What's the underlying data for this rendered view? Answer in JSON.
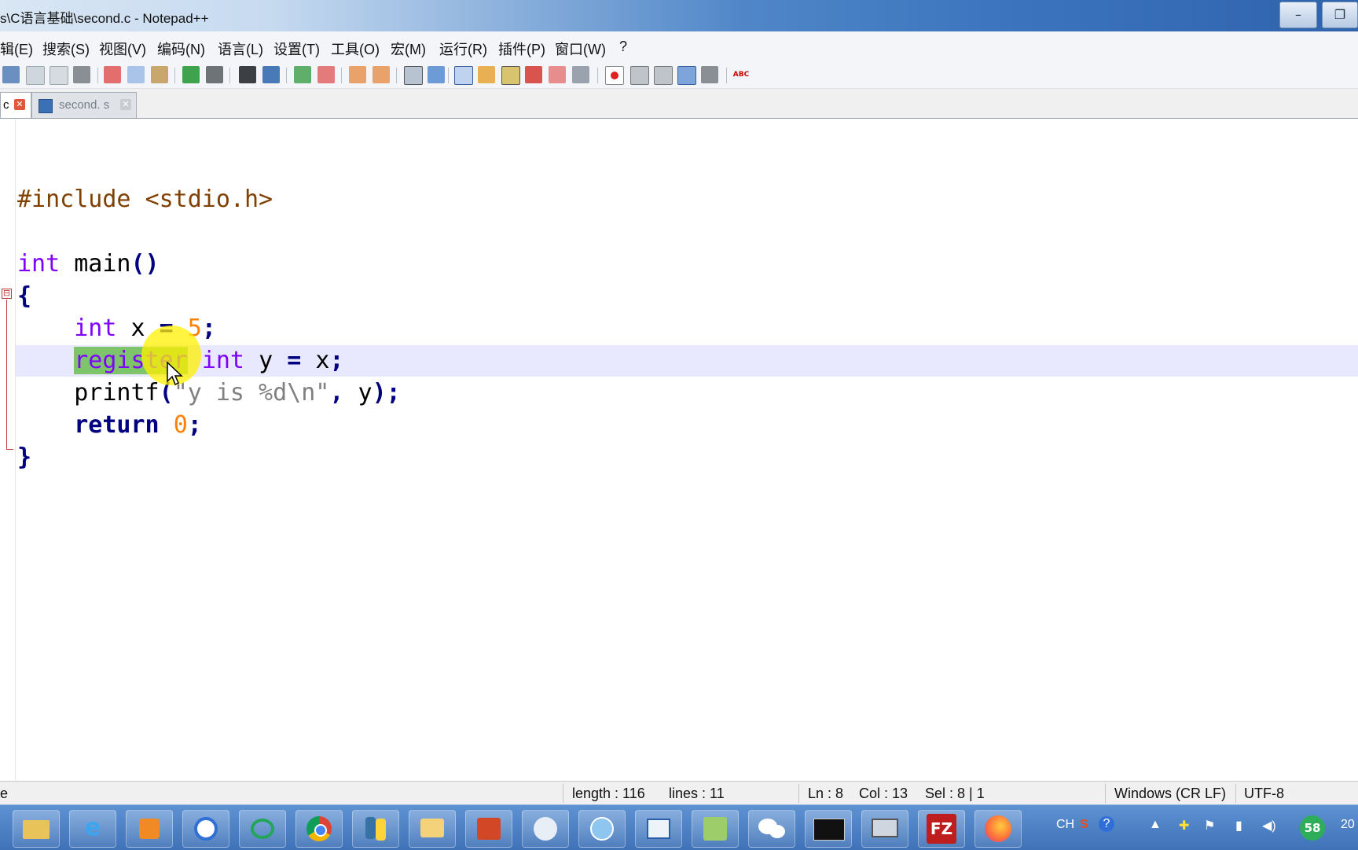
{
  "window": {
    "title": "s\\C语言基础\\second.c - Notepad++",
    "minimize_glyph": "–",
    "restore_glyph": "❐"
  },
  "menu": {
    "items": [
      "辑(E)",
      "搜索(S)",
      "视图(V)",
      "编码(N)",
      "语言(L)",
      "设置(T)",
      "工具(O)",
      "宏(M)",
      "运行(R)",
      "插件(P)",
      "窗口(W)",
      "?"
    ]
  },
  "toolbar": {
    "icons": [
      "new-file-icon",
      "open-file-icon",
      "save-icon",
      "save-all-icon",
      "close-icon",
      "close-all-icon",
      "print-icon",
      "cut-icon",
      "copy-icon",
      "paste-icon",
      "undo-icon",
      "redo-icon",
      "find-icon",
      "replace-icon",
      "zoom-in-icon",
      "zoom-out-icon",
      "sync-v-icon",
      "sync-h-icon",
      "word-wrap-icon",
      "show-all-chars-icon",
      "indent-guide-icon",
      "user-lang-icon",
      "doc-map-icon",
      "function-list-icon",
      "folder-workspace-icon",
      "monitor-icon",
      "record-macro-icon",
      "stop-record-icon",
      "playback-icon",
      "run-multiple-icon",
      "save-macro-icon",
      "spellcheck-icon"
    ],
    "spellcheck_label": "ABC"
  },
  "tabs": [
    {
      "label": "c",
      "active": true
    },
    {
      "label": "second. s",
      "active": false
    }
  ],
  "tab_close_glyph": "✕",
  "editor": {
    "fold_open": "⊟",
    "lines": {
      "include_kw": "#include",
      "include_file": "<stdio.h>",
      "int_kw": "int",
      "main_name": "main",
      "main_parens": "()",
      "brace_open": "{",
      "l5_int": "int",
      "l5_var": "x",
      "l5_eq": "=",
      "l5_num": "5",
      "l5_semi": ";",
      "l6_register": "register",
      "l6_int": "int",
      "l6_var": "y",
      "l6_eq": "=",
      "l6_src": "x",
      "l6_semi": ";",
      "l7_func": "printf",
      "l7_paren_open": "(",
      "l7_str": "\"y is %d\\n\"",
      "l7_comma": ",",
      "l7_arg": "y",
      "l7_paren_close": ")",
      "l7_semi": ";",
      "l8_return": "return",
      "l8_num": "0",
      "l8_semi": ";",
      "brace_close": "}"
    }
  },
  "status": {
    "file_type": "e",
    "length": "length : 116",
    "lines": "lines : 11",
    "ln": "Ln : 8",
    "col": "Col : 13",
    "sel": "Sel : 8 | 1",
    "eol": "Windows (CR LF)",
    "encoding": "UTF-8"
  },
  "taskbar": {
    "apps": [
      "file-explorer-icon",
      "internet-explorer-icon",
      "media-player-icon",
      "baidu-netdisk-icon",
      "cloud-app-icon",
      "chrome-icon",
      "python-icon",
      "outlook-icon",
      "powerpoint-icon",
      "app-bird-icon",
      "network-icon",
      "document-viewer-icon",
      "notepad-plus-plus-icon",
      "wechat-icon",
      "cmd-terminal-icon",
      "remote-desktop-icon",
      "filezilla-icon",
      "firefox-icon"
    ],
    "filezilla_glyph": "FZ",
    "tray_lang": "CH",
    "tray_badge": "58",
    "clock_partial": "20"
  },
  "colors": {
    "keyword": "#8000ff",
    "keyword_bold": "#000080",
    "number": "#ff8000",
    "string": "#808080",
    "preprocessor": "#804000",
    "selection": "#7ec46a",
    "current_line": "#e8e8ff"
  }
}
